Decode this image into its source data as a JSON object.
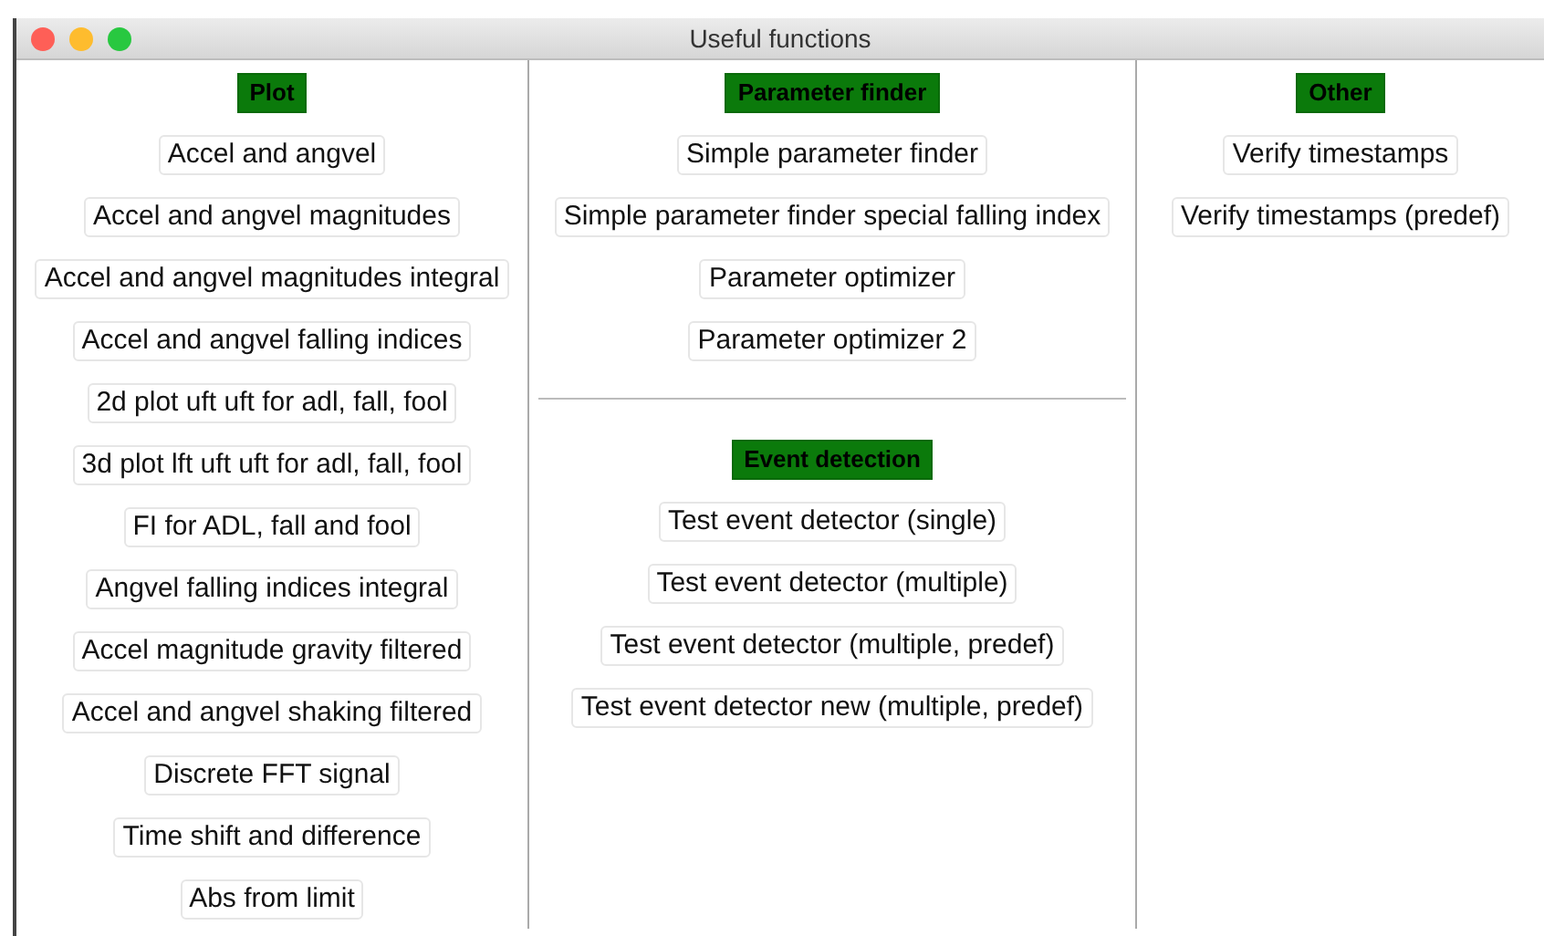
{
  "window": {
    "title": "Useful functions"
  },
  "columns": [
    {
      "sections": [
        {
          "title": "Plot",
          "buttons": [
            "Accel and angvel",
            "Accel and angvel magnitudes",
            "Accel and angvel magnitudes integral",
            "Accel and angvel falling indices",
            "2d plot uft uft for adl, fall, fool",
            "3d plot lft uft uft for adl, fall, fool",
            "FI for ADL, fall and fool",
            "Angvel falling indices integral",
            "Accel magnitude gravity filtered",
            "Accel and angvel shaking filtered",
            "Discrete FFT signal",
            "Time shift and difference",
            "Abs from limit"
          ]
        }
      ]
    },
    {
      "sections": [
        {
          "title": "Parameter finder",
          "buttons": [
            "Simple parameter finder",
            "Simple parameter finder special falling index",
            "Parameter optimizer",
            "Parameter optimizer 2"
          ]
        },
        {
          "title": "Event detection",
          "buttons": [
            "Test event detector (single)",
            "Test event detector (multiple)",
            "Test event detector (multiple, predef)",
            "Test event detector new (multiple, predef)"
          ]
        }
      ]
    },
    {
      "sections": [
        {
          "title": "Other",
          "buttons": [
            "Verify timestamps",
            "Verify timestamps (predef)"
          ]
        }
      ]
    }
  ]
}
